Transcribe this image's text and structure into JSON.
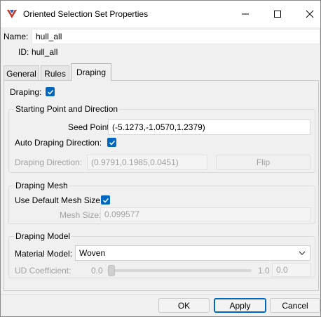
{
  "window": {
    "title": "Oriented Selection Set Properties",
    "controls": {
      "minimize_icon": "minimize-icon",
      "maximize_icon": "maximize-icon",
      "close_icon": "close-icon"
    }
  },
  "header": {
    "name_label": "Name:",
    "name_value": "hull_all",
    "id_label": "ID:",
    "id_value": "hull_all"
  },
  "tabs": [
    {
      "label": "General",
      "active": false
    },
    {
      "label": "Rules",
      "active": false
    },
    {
      "label": "Draping",
      "active": true
    }
  ],
  "draping": {
    "enabled_label": "Draping:",
    "enabled": true,
    "starting_point": {
      "title": "Starting Point and Direction",
      "seed_label": "Seed Point:",
      "seed_value": "(-5.1273,-1.0570,1.2379)",
      "auto_label": "Auto Draping Direction:",
      "auto_checked": true,
      "direction_label": "Draping Direction:",
      "direction_value": "(0.9791,0.1985,0.0451)",
      "flip_label": "Flip"
    },
    "mesh": {
      "title": "Draping Mesh",
      "default_label": "Use Default Mesh Size:",
      "default_checked": true,
      "size_label": "Mesh Size:",
      "size_value": "0.099577"
    },
    "model": {
      "title": "Draping Model",
      "material_label": "Material Model:",
      "material_value": "Woven",
      "ud_label": "UD Coefficient:",
      "ud_min": "0.0",
      "ud_max": "1.0",
      "ud_value": "0.0",
      "ud_level": 0.0
    }
  },
  "footer": {
    "ok_label": "OK",
    "apply_label": "Apply",
    "cancel_label": "Cancel"
  },
  "colors": {
    "accent": "#0067c0",
    "disabled_text": "#a0a0a0"
  }
}
